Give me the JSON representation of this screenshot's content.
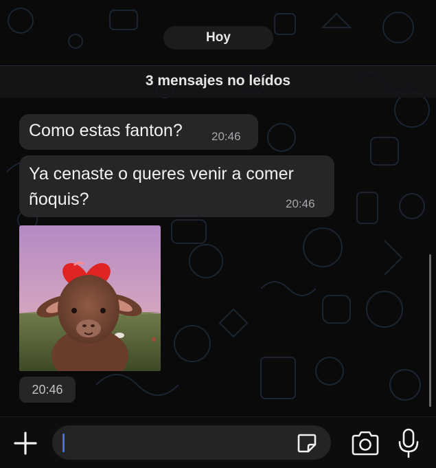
{
  "chat": {
    "date_label": "Hoy",
    "unread_label": "3 mensajes no leídos",
    "messages": [
      {
        "text": "Como estas fanton?",
        "time": "20:46"
      },
      {
        "text": "Ya cenaste o queres venir a comer ñoquis?",
        "time": "20:46"
      }
    ],
    "photo": {
      "subject": "lamb with heart",
      "time": "20:46"
    }
  },
  "input_bar": {
    "icons": [
      "plus-icon",
      "sticker-icon",
      "camera-icon",
      "microphone-icon"
    ],
    "accent": "#2f7bea"
  },
  "colors": {
    "background": "#0a0a0b",
    "bubble": "#262628",
    "wallpaper_doodle": "#1b2531"
  }
}
